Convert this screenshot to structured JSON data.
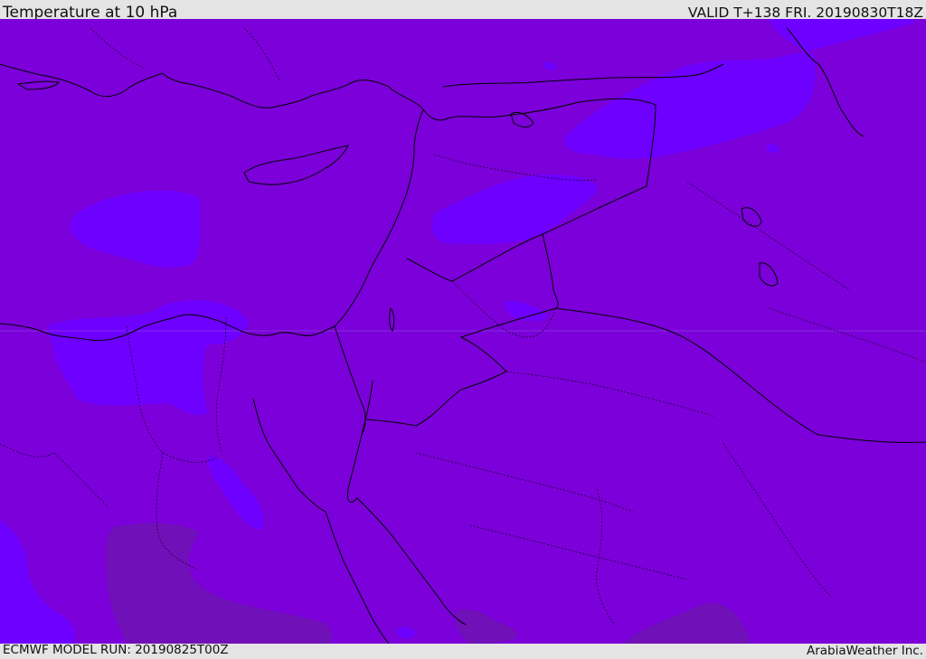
{
  "header": {
    "title": "Temperature at 10 hPa",
    "valid": "VALID T+138 FRI. 20190830T18Z"
  },
  "footer": {
    "model_run": "ECMWF MODEL RUN: 20190825T00Z",
    "credit": "ArabiaWeather Inc."
  },
  "colors": {
    "background_field": "#7b00d9",
    "warm_patch": "#6e00ff",
    "cool_patch": "#7010b8",
    "frame": "#e4e4e4",
    "coastline": "#000000"
  },
  "map": {
    "layers": [
      "temperature-field",
      "coastlines",
      "country-borders",
      "province-borders"
    ]
  }
}
